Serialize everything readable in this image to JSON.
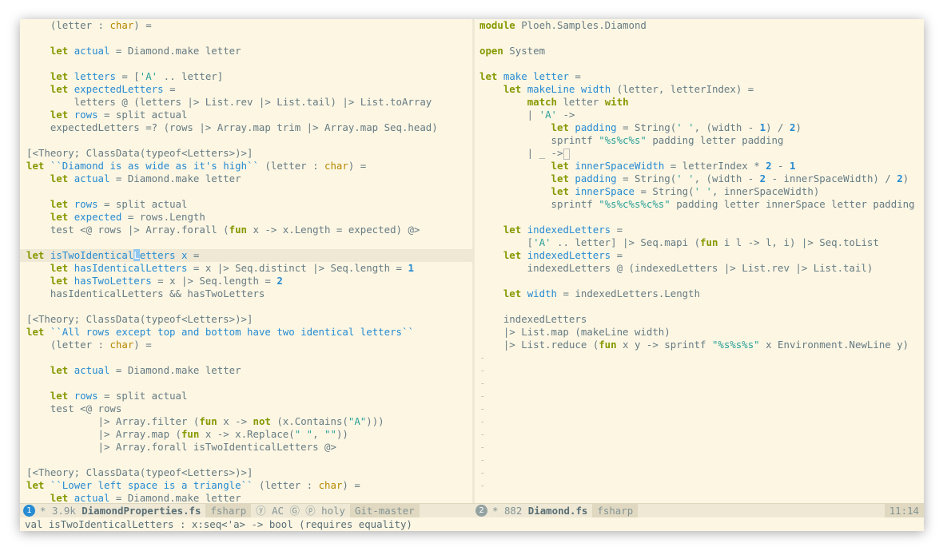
{
  "left_editor": {
    "lines": [
      "    (letter : char) =",
      "",
      "    let actual = Diamond.make letter",
      "",
      "    let letters = ['A' .. letter]",
      "    let expectedLetters =",
      "        letters @ (letters |> List.rev |> List.tail) |> List.toArray",
      "    let rows = split actual",
      "    expectedLetters =? (rows |> Array.map trim |> Array.map Seq.head)",
      "",
      "[<Theory; ClassData(typeof<Letters>)>]",
      "let ``Diamond is as wide as it's high`` (letter : char) =",
      "    let actual = Diamond.make letter",
      "",
      "    let rows = split actual",
      "    let expected = rows.Length",
      "    test <@ rows |> Array.forall (fun x -> x.Length = expected) @>",
      "",
      "let isTwoIdenticalLetters x =",
      "    let hasIdenticalLetters = x |> Seq.distinct |> Seq.length = 1",
      "    let hasTwoLetters = x |> Seq.length = 2",
      "    hasIdenticalLetters && hasTwoLetters",
      "",
      "[<Theory; ClassData(typeof<Letters>)>]",
      "let ``All rows except top and bottom have two identical letters``",
      "    (letter : char) =",
      "",
      "    let actual = Diamond.make letter",
      "",
      "    let rows = split actual",
      "    test <@ rows",
      "            |> Array.filter (fun x -> not (x.Contains(\"A\")))",
      "            |> Array.map (fun x -> x.Replace(\" \", \"\"))",
      "            |> Array.forall isTwoIdenticalLetters @>",
      "",
      "[<Theory; ClassData(typeof<Letters>)>]",
      "let ``Lower left space is a triangle`` (letter : char) =",
      "    let actual = Diamond.make letter"
    ],
    "highlight_line": 18
  },
  "right_editor": {
    "lines": [
      "module Ploeh.Samples.Diamond",
      "",
      "open System",
      "",
      "let make letter =",
      "    let makeLine width (letter, letterIndex) =",
      "        match letter with",
      "        | 'A' ->",
      "            let padding = String(' ', (width - 1) / 2)",
      "            sprintf \"%s%c%s\" padding letter padding",
      "        | _ ->",
      "            let innerSpaceWidth = letterIndex * 2 - 1",
      "            let padding = String(' ', (width - 2 - innerSpaceWidth) / 2)",
      "            let innerSpace = String(' ', innerSpaceWidth)",
      "            sprintf \"%s%c%s%c%s\" padding letter innerSpace letter padding",
      "",
      "    let indexedLetters =",
      "        ['A' .. letter] |> Seq.mapi (fun i l -> l, i) |> Seq.toList",
      "    let indexedLetters =",
      "        indexedLetters @ (indexedLetters |> List.rev |> List.tail)",
      "",
      "    let width = indexedLetters.Length",
      "",
      "    indexedLetters",
      "    |> List.map (makeLine width)",
      "    |> List.reduce (fun x y -> sprintf \"%s%s%s\" x Environment.NewLine y)"
    ],
    "empty_line_marker": "-",
    "empty_line_count": 11
  },
  "modeline_left": {
    "window_number": "1",
    "modified": "*",
    "size": "3.9k",
    "filename": "DiamondProperties.fs",
    "major_mode": "fsharp",
    "minor_modes": "ⓨ AC Ⓖ ⓟ holy",
    "vcs": "Git-master"
  },
  "modeline_right": {
    "window_number": "2",
    "modified": "*",
    "size": "882",
    "filename": "Diamond.fs",
    "major_mode": "fsharp",
    "position": "11:14"
  },
  "echo_area": "val isTwoIdenticalLetters : x:seq<'a> -> bool (requires equality)",
  "colors": {
    "background": "#fdf6e3",
    "keyword": "#859900",
    "name": "#268bd2",
    "type": "#b58900",
    "string": "#2aa198",
    "text": "#657b83",
    "modeline": "#eee8d5"
  }
}
